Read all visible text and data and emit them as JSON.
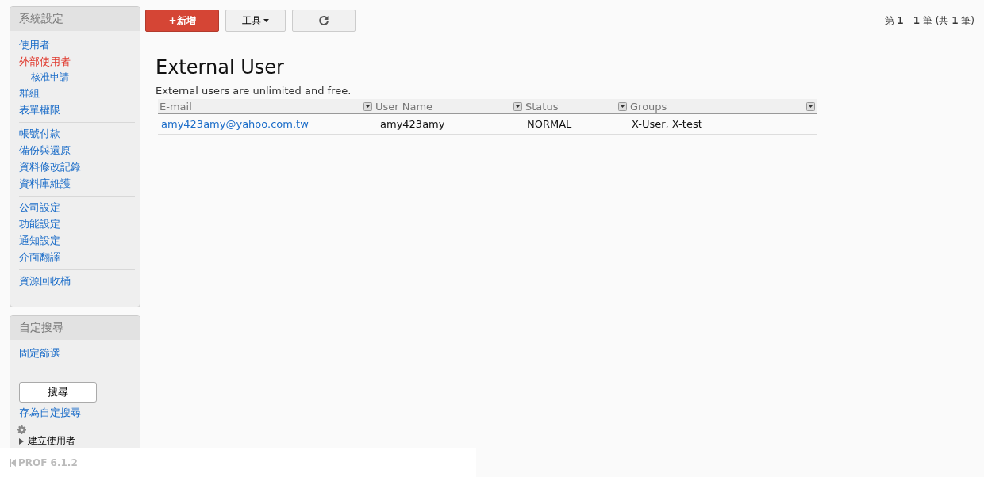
{
  "sidebar": {
    "title": "系統設定",
    "groups": [
      [
        {
          "label": "使用者",
          "selected": false
        },
        {
          "label": "外部使用者",
          "selected": true,
          "children": [
            {
              "label": "核准申請",
              "selected": false
            }
          ]
        },
        {
          "label": "群組",
          "selected": false
        },
        {
          "label": "表單權限",
          "selected": false
        }
      ],
      [
        {
          "label": "帳號付款",
          "selected": false
        },
        {
          "label": "備份與還原",
          "selected": false
        },
        {
          "label": "資料修改記錄",
          "selected": false
        },
        {
          "label": "資料庫維護",
          "selected": false
        }
      ],
      [
        {
          "label": "公司設定",
          "selected": false
        },
        {
          "label": "功能設定",
          "selected": false
        },
        {
          "label": "通知設定",
          "selected": false
        },
        {
          "label": "介面翻譯",
          "selected": false
        }
      ],
      [
        {
          "label": "資源回收桶",
          "selected": false
        }
      ]
    ]
  },
  "search_panel": {
    "title": "自定搜尋",
    "filter_link": "固定篩選",
    "search_button": "搜尋",
    "save_link": "存為自定搜尋",
    "tree_item": "建立使用者"
  },
  "toolbar": {
    "add_button": "+新增",
    "tools_button": "工具"
  },
  "pagination": "第 **1** - **1** 筆 (共 **1** 筆)",
  "page": {
    "title": "External User",
    "description": "External users are unlimited and free."
  },
  "table": {
    "columns": [
      "E-mail",
      "User Name",
      "Status",
      "Groups"
    ],
    "rows": [
      [
        "amy423amy@yahoo.com.tw",
        "amy423amy",
        "NORMAL",
        "X-User, X-test"
      ]
    ]
  },
  "footer": {
    "version": "PROF 6.1.2"
  }
}
